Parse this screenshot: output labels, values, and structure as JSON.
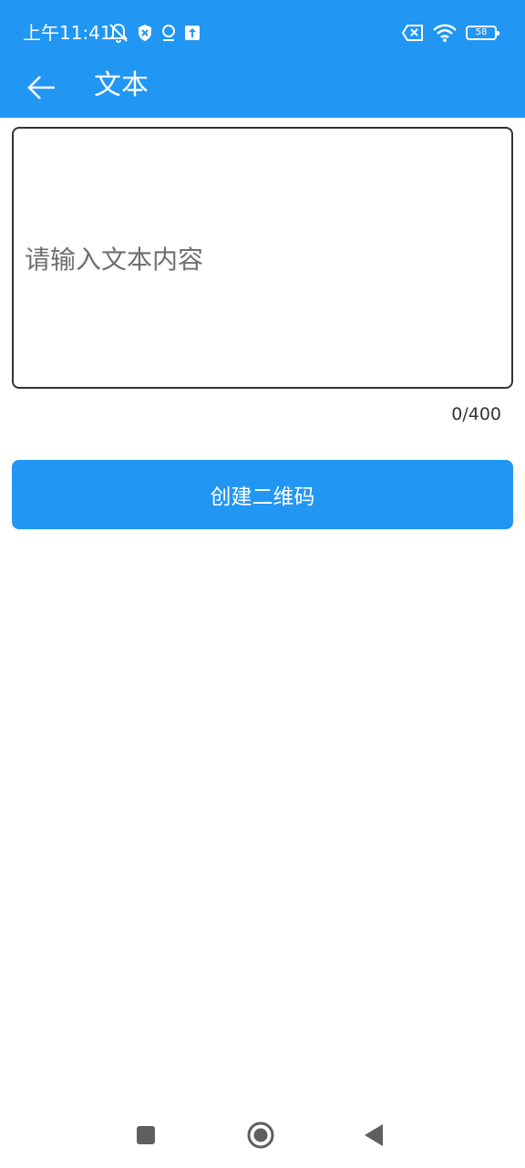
{
  "status_bar": {
    "time": "上午11:41",
    "battery_level": "58",
    "left_icons": [
      "notifications-muted-icon",
      "shield-icon",
      "location-icon",
      "upload-icon"
    ],
    "right_icons": [
      "sim-off-icon",
      "wifi-icon",
      "battery-icon"
    ]
  },
  "toolbar": {
    "title": "文本",
    "back_icon": "arrow-left-icon"
  },
  "text_input": {
    "placeholder": "请输入文本内容",
    "value": ""
  },
  "char_counter": "0/400",
  "create_button": {
    "label": "创建二维码"
  },
  "nav_bar": {
    "icons": [
      "recents-icon",
      "home-icon",
      "back-icon"
    ]
  },
  "colors": {
    "primary": "#2196F3",
    "border": "#333333",
    "placeholder": "#6f6f6f",
    "nav_icon": "#5f5f5f"
  }
}
